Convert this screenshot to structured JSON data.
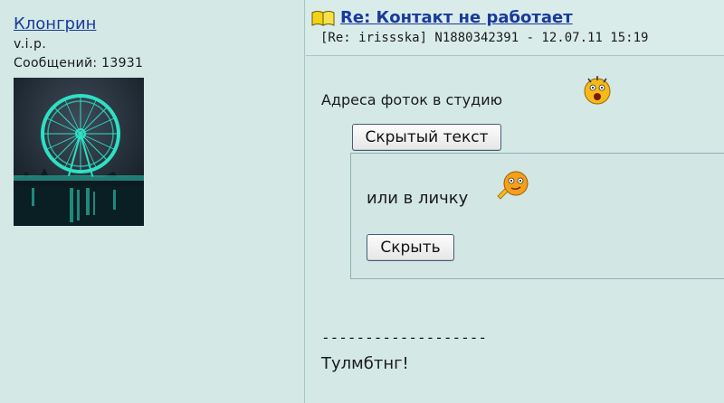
{
  "author": {
    "name": "Клонгрин",
    "rank": "v.i.p.",
    "messages_label": "Сообщений: 13931"
  },
  "post": {
    "title": "Re: Контакт не работает",
    "meta": "[Re: irissska]  N1880342391 - 12.07.11 15:19",
    "line1": "Адреса фоток в студию",
    "spoiler_show_label": "Скрытый текст",
    "spoiler_text": "или в личку",
    "spoiler_hide_label": "Скрыть",
    "separator": "-------------------",
    "signoff": "Тулмбтнг!"
  },
  "colors": {
    "background": "#d4e8e6",
    "link": "#1a3a9a"
  },
  "icons": [
    "book-icon",
    "scared-smiley-icon",
    "pointing-smiley-icon"
  ]
}
